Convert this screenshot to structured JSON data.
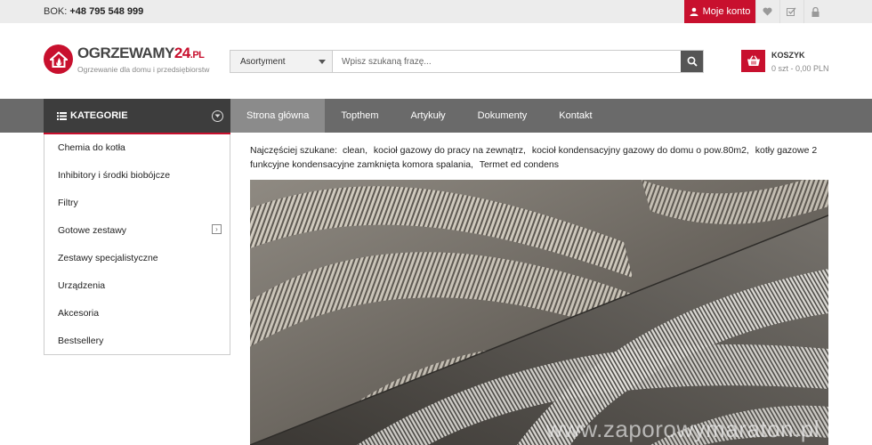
{
  "topbar": {
    "bok_label": "BOK:",
    "bok_phone": "+48 795 548 999",
    "account_label": "Moje konto"
  },
  "logo": {
    "name_main": "OGRZEWAMY",
    "name_accent": "24",
    "name_suffix": ".PL",
    "tagline": "Ogrzewanie dla domu i przedsiębiorstw"
  },
  "search": {
    "category": "Asortyment",
    "placeholder": "Wpisz szukaną frazę..."
  },
  "cart": {
    "title": "KOSZYK",
    "summary": "0 szt - 0,00 PLN"
  },
  "nav": {
    "categories_label": "KATEGORIE",
    "items": [
      {
        "label": "Strona główna"
      },
      {
        "label": "Topthem"
      },
      {
        "label": "Artykuły"
      },
      {
        "label": "Dokumenty"
      },
      {
        "label": "Kontakt"
      }
    ]
  },
  "sidebar": {
    "items": [
      {
        "label": "Chemia do kotła"
      },
      {
        "label": "Inhibitory i środki biobójcze"
      },
      {
        "label": "Filtry"
      },
      {
        "label": "Gotowe zestawy"
      },
      {
        "label": "Zestawy specjalistyczne"
      },
      {
        "label": "Urządzenia"
      },
      {
        "label": "Akcesoria"
      },
      {
        "label": "Bestsellery"
      }
    ]
  },
  "popular": {
    "label": "Najczęściej szukane:",
    "links": [
      "clean,",
      "kocioł gazowy do pracy na zewnątrz,",
      "kocioł kondensacyjny gazowy do domu o pow.80m2,",
      "kotły gazowe 2 funkcyjne kondensacyjne zamknięta komora spalania,",
      "Termet ed condens"
    ]
  },
  "hero": {
    "watermark": "www.zaporowymaraton.pl"
  },
  "colors": {
    "accent": "#c8102e",
    "nav_bg": "#6a6a6a",
    "category_bg": "#3d3d3d"
  }
}
